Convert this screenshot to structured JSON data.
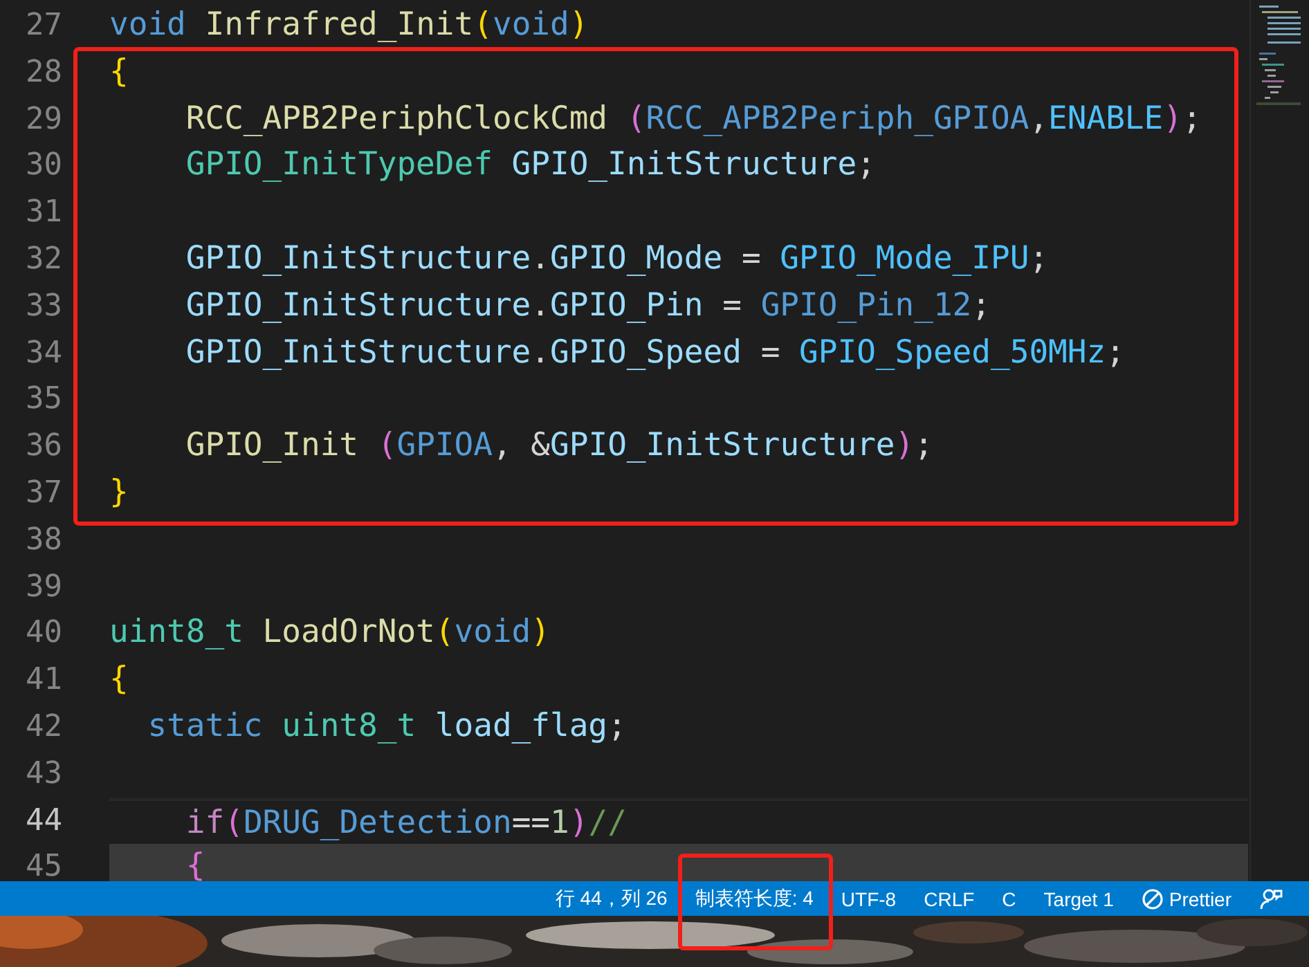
{
  "editor": {
    "lines": [
      {
        "number": "27",
        "current": false,
        "highlighted": false,
        "boxed": false,
        "tokens": [
          {
            "text": "void ",
            "kind": "keyword"
          },
          {
            "text": "Infrafred_Init",
            "kind": "function"
          },
          {
            "text": "(",
            "kind": "bracket1"
          },
          {
            "text": "void",
            "kind": "keyword"
          },
          {
            "text": ")",
            "kind": "bracket1"
          }
        ]
      },
      {
        "number": "28",
        "current": false,
        "highlighted": false,
        "boxed": true,
        "tokens": [
          {
            "text": "{",
            "kind": "bracket1"
          }
        ]
      },
      {
        "number": "29",
        "current": false,
        "highlighted": false,
        "boxed": true,
        "tokens": [
          {
            "text": "    RCC_APB2PeriphClockCmd ",
            "kind": "function"
          },
          {
            "text": "(",
            "kind": "bracket2"
          },
          {
            "text": "RCC_APB2Periph_GPIOA",
            "kind": "macro"
          },
          {
            "text": ",",
            "kind": "plain"
          },
          {
            "text": "ENABLE",
            "kind": "constant"
          },
          {
            "text": ")",
            "kind": "bracket2"
          },
          {
            "text": ";",
            "kind": "plain"
          }
        ]
      },
      {
        "number": "30",
        "current": false,
        "highlighted": false,
        "boxed": true,
        "tokens": [
          {
            "text": "    GPIO_InitTypeDef ",
            "kind": "type"
          },
          {
            "text": "GPIO_InitStructure",
            "kind": "variable"
          },
          {
            "text": ";",
            "kind": "plain"
          }
        ]
      },
      {
        "number": "31",
        "current": false,
        "highlighted": false,
        "boxed": true
      },
      {
        "number": "32",
        "current": false,
        "highlighted": false,
        "boxed": true,
        "tokens": [
          {
            "text": "    GPIO_InitStructure",
            "kind": "variable"
          },
          {
            "text": ".",
            "kind": "plain"
          },
          {
            "text": "GPIO_Mode",
            "kind": "variable"
          },
          {
            "text": " = ",
            "kind": "plain"
          },
          {
            "text": "GPIO_Mode_IPU",
            "kind": "constant"
          },
          {
            "text": ";",
            "kind": "plain"
          }
        ]
      },
      {
        "number": "33",
        "current": false,
        "highlighted": false,
        "boxed": true,
        "tokens": [
          {
            "text": "    GPIO_InitStructure",
            "kind": "variable"
          },
          {
            "text": ".",
            "kind": "plain"
          },
          {
            "text": "GPIO_Pin",
            "kind": "variable"
          },
          {
            "text": " = ",
            "kind": "plain"
          },
          {
            "text": "GPIO_Pin_12",
            "kind": "macro"
          },
          {
            "text": ";",
            "kind": "plain"
          }
        ]
      },
      {
        "number": "34",
        "current": false,
        "highlighted": false,
        "boxed": true,
        "tokens": [
          {
            "text": "    GPIO_InitStructure",
            "kind": "variable"
          },
          {
            "text": ".",
            "kind": "plain"
          },
          {
            "text": "GPIO_Speed",
            "kind": "variable"
          },
          {
            "text": " = ",
            "kind": "plain"
          },
          {
            "text": "GPIO_Speed_50MHz",
            "kind": "constant"
          },
          {
            "text": ";",
            "kind": "plain"
          }
        ]
      },
      {
        "number": "35",
        "current": false,
        "highlighted": false,
        "boxed": true
      },
      {
        "number": "36",
        "current": false,
        "highlighted": false,
        "boxed": true,
        "tokens": [
          {
            "text": "    GPIO_Init ",
            "kind": "function"
          },
          {
            "text": "(",
            "kind": "bracket2"
          },
          {
            "text": "GPIOA",
            "kind": "macro"
          },
          {
            "text": ", &",
            "kind": "plain"
          },
          {
            "text": "GPIO_InitStructure",
            "kind": "variable"
          },
          {
            "text": ")",
            "kind": "bracket2"
          },
          {
            "text": ";",
            "kind": "plain"
          }
        ]
      },
      {
        "number": "37",
        "current": false,
        "highlighted": false,
        "boxed": true,
        "tokens": [
          {
            "text": "}",
            "kind": "bracket1"
          }
        ]
      },
      {
        "number": "38",
        "current": false,
        "highlighted": false,
        "boxed": false
      },
      {
        "number": "39",
        "current": false,
        "highlighted": false,
        "boxed": false
      },
      {
        "number": "40",
        "current": false,
        "highlighted": false,
        "boxed": false,
        "tokens": [
          {
            "text": "uint8_t ",
            "kind": "type"
          },
          {
            "text": "LoadOrNot",
            "kind": "function"
          },
          {
            "text": "(",
            "kind": "bracket1"
          },
          {
            "text": "void",
            "kind": "keyword"
          },
          {
            "text": ")",
            "kind": "bracket1"
          }
        ]
      },
      {
        "number": "41",
        "current": false,
        "highlighted": false,
        "boxed": false,
        "tokens": [
          {
            "text": "{",
            "kind": "bracket1"
          }
        ]
      },
      {
        "number": "42",
        "current": false,
        "highlighted": false,
        "boxed": false,
        "tokens": [
          {
            "text": "  static ",
            "kind": "keyword"
          },
          {
            "text": "uint8_t ",
            "kind": "type"
          },
          {
            "text": "load_flag",
            "kind": "variable"
          },
          {
            "text": ";",
            "kind": "plain"
          }
        ]
      },
      {
        "number": "43",
        "current": false,
        "highlighted": false,
        "boxed": false
      },
      {
        "number": "44",
        "current": true,
        "highlighted": false,
        "boxed": false,
        "tokens": [
          {
            "text": "    if",
            "kind": "control"
          },
          {
            "text": "(",
            "kind": "bracket2"
          },
          {
            "text": "DRUG_Detection",
            "kind": "macro"
          },
          {
            "text": "==",
            "kind": "plain"
          },
          {
            "text": "1",
            "kind": "number"
          },
          {
            "text": ")",
            "kind": "bracket2"
          },
          {
            "text": "//",
            "kind": "comment"
          }
        ]
      },
      {
        "number": "45",
        "current": false,
        "highlighted": true,
        "boxed": false,
        "tokens": [
          {
            "text": "    {",
            "kind": "bracket2"
          }
        ]
      }
    ]
  },
  "status_bar": {
    "items": [
      {
        "kind": "text",
        "text": "行 44，列 26",
        "boxed": false
      },
      {
        "kind": "text",
        "text": "制表符长度: 4",
        "boxed": true
      },
      {
        "kind": "text",
        "text": "UTF-8",
        "boxed": false
      },
      {
        "kind": "text",
        "text": "CRLF",
        "boxed": false
      },
      {
        "kind": "text",
        "text": "C",
        "boxed": false
      },
      {
        "kind": "text",
        "text": "Target 1",
        "boxed": false
      },
      {
        "kind": "blocked",
        "text": "Prettier",
        "boxed": false
      },
      {
        "kind": "feedback",
        "boxed": false
      }
    ]
  }
}
